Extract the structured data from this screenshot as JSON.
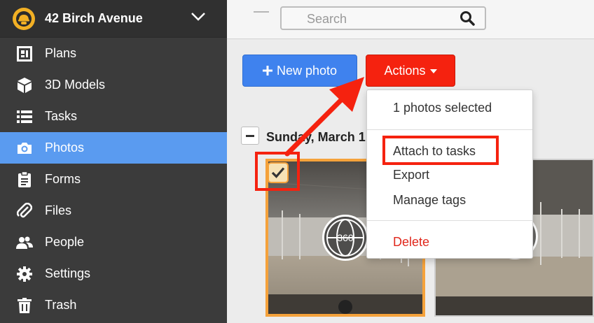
{
  "project": {
    "name": "42 Birch Avenue"
  },
  "sidebar": {
    "items": [
      {
        "label": "Plans",
        "icon": "plans-icon"
      },
      {
        "label": "3D Models",
        "icon": "cube-icon"
      },
      {
        "label": "Tasks",
        "icon": "list-icon"
      },
      {
        "label": "Photos",
        "icon": "camera-icon",
        "active": true
      },
      {
        "label": "Forms",
        "icon": "clipboard-icon"
      },
      {
        "label": "Files",
        "icon": "paperclip-icon"
      },
      {
        "label": "People",
        "icon": "people-icon"
      },
      {
        "label": "Settings",
        "icon": "gear-icon"
      },
      {
        "label": "Trash",
        "icon": "trash-icon"
      }
    ]
  },
  "search": {
    "placeholder": "Search"
  },
  "toolbar": {
    "new_photo_label": "New photo",
    "actions_label": "Actions"
  },
  "gallery": {
    "date_heading": "Sunday, March 1",
    "badge_text": "360"
  },
  "actions_menu": {
    "selected_text": "1 photos selected",
    "attach": "Attach to tasks",
    "export": "Export",
    "manage_tags": "Manage tags",
    "delete": "Delete"
  },
  "colors": {
    "sidebar_bg": "#3b3b3b",
    "active_item": "#5a9bf0",
    "primary_button": "#3f82ee",
    "actions_button": "#f5220f",
    "selection_border": "#f5a23b",
    "delete_text": "#e0281d",
    "annotation": "#f5220f"
  }
}
